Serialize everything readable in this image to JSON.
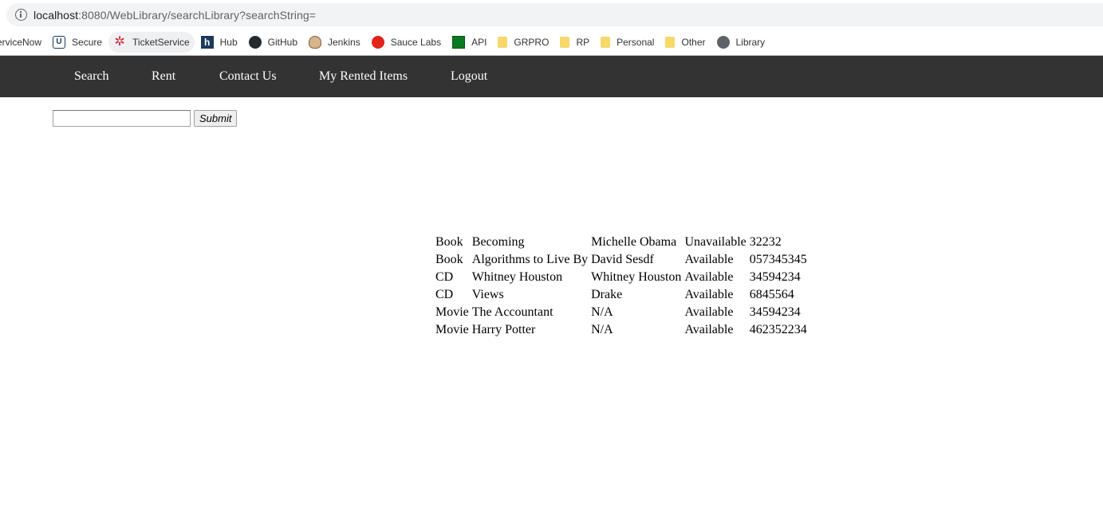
{
  "browser": {
    "url_host": "localhost",
    "url_path": ":8080/WebLibrary/searchLibrary?searchString="
  },
  "bookmarks": [
    {
      "label": "erviceNow",
      "icon": "none"
    },
    {
      "label": "Secure",
      "icon": "secure-icon"
    },
    {
      "label": "TicketService",
      "icon": "ticket-icon"
    },
    {
      "label": "Hub",
      "icon": "hub-icon"
    },
    {
      "label": "GitHub",
      "icon": "github-icon"
    },
    {
      "label": "Jenkins",
      "icon": "jenkins-icon"
    },
    {
      "label": "Sauce Labs",
      "icon": "sauce-icon"
    },
    {
      "label": "API",
      "icon": "api-icon"
    },
    {
      "label": "GRPRO",
      "icon": "folder-icon"
    },
    {
      "label": "RP",
      "icon": "folder-icon"
    },
    {
      "label": "Personal",
      "icon": "folder-icon"
    },
    {
      "label": "Other",
      "icon": "folder-icon"
    },
    {
      "label": "Library",
      "icon": "globe-icon"
    }
  ],
  "nav": {
    "search": "Search",
    "rent": "Rent",
    "contact": "Contact Us",
    "rented": "My Rented Items",
    "logout": "Logout"
  },
  "search": {
    "value": "",
    "submit_label": "Submit"
  },
  "results": {
    "rows": [
      [
        "Book",
        "Becoming",
        "Michelle Obama",
        "Unavailable",
        "32232"
      ],
      [
        "Book",
        "Algorithms to Live By",
        "David Sesdf",
        "Available",
        "057345345"
      ],
      [
        "CD",
        "Whitney Houston",
        "Whitney Houston",
        "Available",
        "34594234"
      ],
      [
        "CD",
        "Views",
        "Drake",
        "Available",
        "6845564"
      ],
      [
        "Movie",
        "The Accountant",
        "N/A",
        "Available",
        "34594234"
      ],
      [
        "Movie",
        "Harry Potter",
        "N/A",
        "Available",
        "462352234"
      ]
    ]
  },
  "colors": {
    "nav_bg": "#333333",
    "nav_text": "#ffffff"
  }
}
